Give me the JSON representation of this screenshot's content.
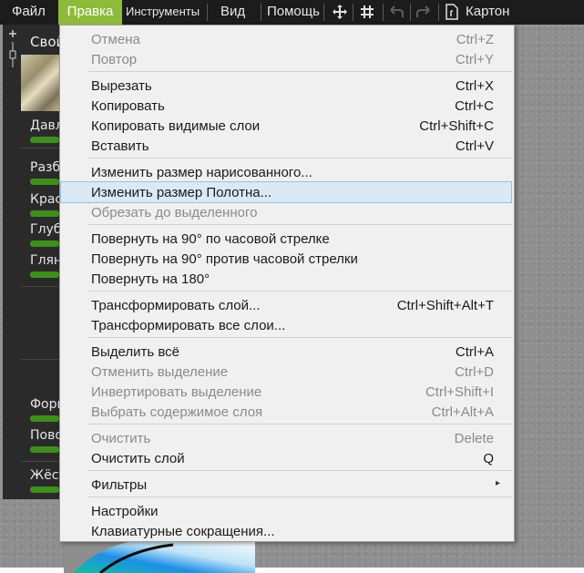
{
  "menubar": {
    "file": "Файл",
    "edit": "Правка",
    "tools": "Инструменты",
    "view": "Вид",
    "help": "Помощь",
    "move_icon": "move-icon",
    "grid_icon": "grid-icon",
    "undo_icon": "undo-icon",
    "redo_icon": "redo-icon",
    "document_icon": "document-icon",
    "document_title": "Картон",
    "active_color": "#8fbb3c"
  },
  "props_panel": {
    "title": "Свойства",
    "labels": [
      "Давление",
      "Разбавление",
      "Краска",
      "Глубина",
      "Глянец",
      "Форма",
      "Поворот",
      "Жёсткость"
    ],
    "slider_color": "#3f8e1e"
  },
  "edit_menu": {
    "undo": {
      "label": "Отмена",
      "shortcut": "Ctrl+Z"
    },
    "redo": {
      "label": "Повтор",
      "shortcut": "Ctrl+Y"
    },
    "cut": {
      "label": "Вырезать",
      "shortcut": "Ctrl+X"
    },
    "copy": {
      "label": "Копировать",
      "shortcut": "Ctrl+C"
    },
    "copy_visible": {
      "label": "Копировать видимые слои",
      "shortcut": "Ctrl+Shift+C"
    },
    "paste": {
      "label": "Вставить",
      "shortcut": "Ctrl+V"
    },
    "resize_painting": {
      "label": "Изменить размер нарисованного..."
    },
    "resize_canvas": {
      "label": "Изменить размер Полотна..."
    },
    "crop_selection": {
      "label": "Обрезать до выделенного"
    },
    "rotate_cw": {
      "label": "Повернуть на 90° по часовой стрелке"
    },
    "rotate_ccw": {
      "label": "Повернуть на 90° против часовой стрелки"
    },
    "rotate_180": {
      "label": "Повернуть на 180°"
    },
    "transform_layer": {
      "label": "Трансформировать слой...",
      "shortcut": "Ctrl+Shift+Alt+T"
    },
    "transform_all": {
      "label": "Трансформировать все слои..."
    },
    "select_all": {
      "label": "Выделить всё",
      "shortcut": "Ctrl+A"
    },
    "deselect": {
      "label": "Отменить выделение",
      "shortcut": "Ctrl+D"
    },
    "invert_selection": {
      "label": "Инвертировать выделение",
      "shortcut": "Ctrl+Shift+I"
    },
    "select_layer_contents": {
      "label": "Выбрать содержимое слоя",
      "shortcut": "Ctrl+Alt+A"
    },
    "clear": {
      "label": "Очистить",
      "shortcut": "Delete"
    },
    "clear_layer": {
      "label": "Очистить слой",
      "shortcut": "Q"
    },
    "filters": {
      "label": "Фильтры"
    },
    "settings": {
      "label": "Настройки"
    },
    "shortcuts": {
      "label": "Клавиатурные сокращения..."
    },
    "highlight_color": "#d9e9f6"
  }
}
